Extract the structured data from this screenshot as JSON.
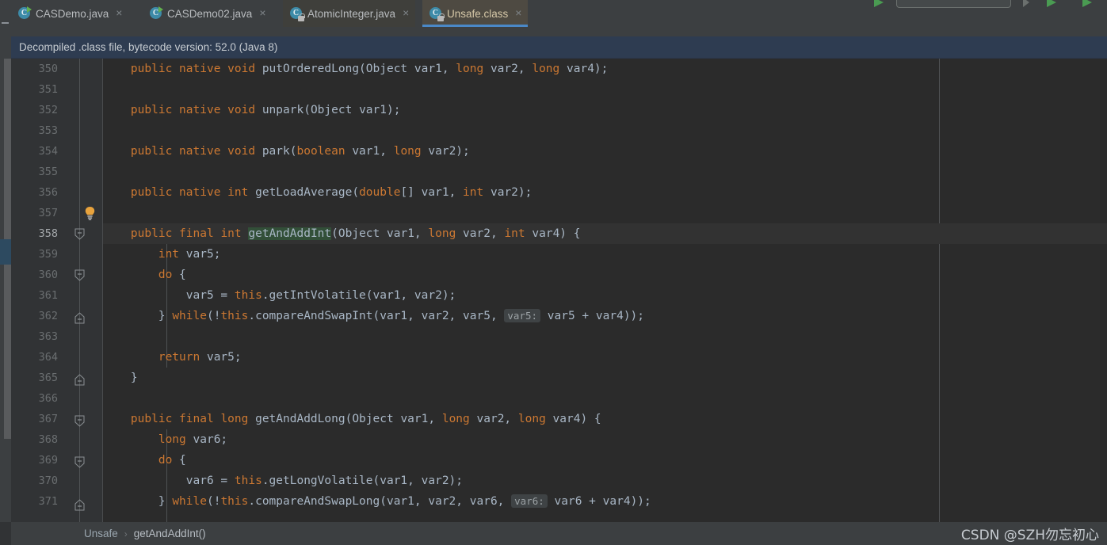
{
  "toolbar": {
    "search_placeholder": "",
    "icons": [
      "run-icon",
      "search-field",
      "chevron-right-icon",
      "run-icon",
      "debug-icon"
    ]
  },
  "tabs": [
    {
      "label": "CASDemo.java",
      "icon": "java-class-run-icon",
      "state": "inactive",
      "close": "×"
    },
    {
      "label": "CASDemo02.java",
      "icon": "java-class-run-icon",
      "state": "inactive",
      "close": "×"
    },
    {
      "label": "AtomicInteger.java",
      "icon": "java-class-lock-icon",
      "state": "dim",
      "close": "×"
    },
    {
      "label": "Unsafe.class",
      "icon": "class-file-lock-icon",
      "state": "active",
      "close": "×"
    }
  ],
  "banner": {
    "text": "Decompiled .class file, bytecode version: 52.0 (Java 8)"
  },
  "editor": {
    "first_line": 350,
    "lines": [
      {
        "n": 350,
        "text": "    public native void putOrderedLong(Object var1, long var2, long var4);"
      },
      {
        "n": 351,
        "text": ""
      },
      {
        "n": 352,
        "text": "    public native void unpark(Object var1);"
      },
      {
        "n": 353,
        "text": ""
      },
      {
        "n": 354,
        "text": "    public native void park(boolean var1, long var2);"
      },
      {
        "n": 355,
        "text": ""
      },
      {
        "n": 356,
        "text": "    public native int getLoadAverage(double[] var1, int var2);"
      },
      {
        "n": 357,
        "text": ""
      },
      {
        "n": 358,
        "text": "    public final int getAndAddInt(Object var1, long var2, int var4) {"
      },
      {
        "n": 359,
        "text": "        int var5;"
      },
      {
        "n": 360,
        "text": "        do {"
      },
      {
        "n": 361,
        "text": "            var5 = this.getIntVolatile(var1, var2);"
      },
      {
        "n": 362,
        "text": "        } while(!this.compareAndSwapInt(var1, var2, var5, var5: var5 + var4));"
      },
      {
        "n": 363,
        "text": ""
      },
      {
        "n": 364,
        "text": "        return var5;"
      },
      {
        "n": 365,
        "text": "    }"
      },
      {
        "n": 366,
        "text": ""
      },
      {
        "n": 367,
        "text": "    public final long getAndAddLong(Object var1, long var2, long var4) {"
      },
      {
        "n": 368,
        "text": "        long var6;"
      },
      {
        "n": 369,
        "text": "        do {"
      },
      {
        "n": 370,
        "text": "            var6 = this.getLongVolatile(var1, var2);"
      },
      {
        "n": 371,
        "text": "        } while(!this.compareAndSwapLong(var1, var2, var6, var6: var6 + var4));"
      }
    ],
    "current_line": 358,
    "highlighted_symbol": "getAndAddInt",
    "inline_hints": [
      "var5:",
      "var6:"
    ],
    "intention_bulb": "lightbulb-icon"
  },
  "breadcrumb": {
    "items": [
      "Unsafe",
      "getAndAddInt()"
    ],
    "separator": "›"
  },
  "watermark": {
    "text": "CSDN @SZH勿忘初心"
  },
  "colors": {
    "editor_bg": "#2b2b2b",
    "gutter_bg": "#313335",
    "chrome_bg": "#3c3f41",
    "banner_bg": "#2e3c51",
    "keyword": "#cc7832",
    "identifier": "#a9b7c6",
    "tab_accent": "#4a88c7",
    "symbol_highlight": "#324f38",
    "marker_blue": "#2d4a60"
  }
}
